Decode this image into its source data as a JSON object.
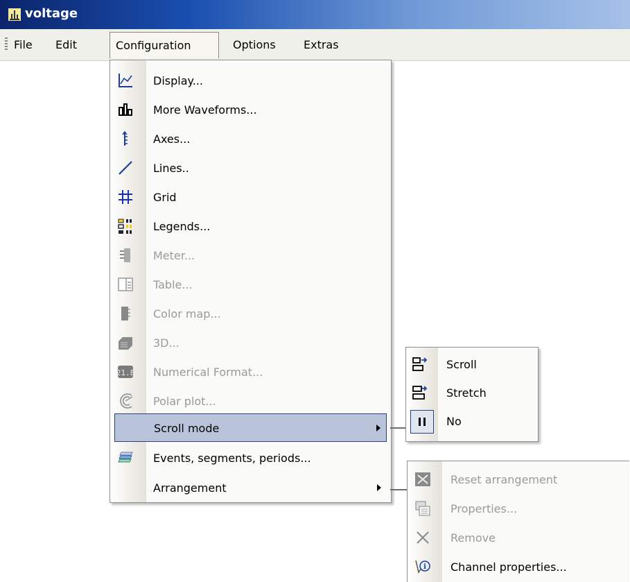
{
  "window": {
    "title": "voltage"
  },
  "menubar": {
    "items": [
      {
        "label": "File"
      },
      {
        "label": "Edit"
      },
      {
        "label": "Configuration"
      },
      {
        "label": "Options"
      },
      {
        "label": "Extras"
      }
    ]
  },
  "configuration_menu": {
    "items": [
      {
        "label": "Display...",
        "icon": "display-chart-icon",
        "enabled": true
      },
      {
        "label": "More Waveforms...",
        "icon": "more-waveforms-icon",
        "enabled": true
      },
      {
        "label": "Axes...",
        "icon": "axes-icon",
        "enabled": true
      },
      {
        "label": "Lines..",
        "icon": "lines-icon",
        "enabled": true
      },
      {
        "label": "Grid",
        "icon": "grid-icon",
        "enabled": true
      },
      {
        "label": "Legends...",
        "icon": "legends-icon",
        "enabled": true
      },
      {
        "label": "Meter...",
        "icon": "meter-icon",
        "enabled": false
      },
      {
        "label": "Table...",
        "icon": "table-icon",
        "enabled": false
      },
      {
        "label": "Color map...",
        "icon": "color-map-icon",
        "enabled": false
      },
      {
        "label": "3D...",
        "icon": "3d-icon",
        "enabled": false
      },
      {
        "label": "Numerical Format...",
        "icon": "numerical-format-icon",
        "enabled": false
      },
      {
        "label": "Polar plot...",
        "icon": "polar-plot-icon",
        "enabled": false
      },
      {
        "label": "Scroll mode",
        "icon": "",
        "enabled": true,
        "submenu": true,
        "highlighted": true
      },
      {
        "label": "Events, segments, periods...",
        "icon": "events-icon",
        "enabled": true
      },
      {
        "label": "Arrangement",
        "icon": "",
        "enabled": true,
        "submenu": true
      }
    ]
  },
  "scroll_mode_menu": {
    "items": [
      {
        "label": "Scroll",
        "icon": "scroll-icon"
      },
      {
        "label": "Stretch",
        "icon": "stretch-icon"
      },
      {
        "label": "No",
        "icon": "pause-icon",
        "checked": true
      }
    ]
  },
  "arrangement_menu": {
    "items": [
      {
        "label": "Reset arrangement",
        "icon": "reset-arrangement-icon",
        "enabled": false
      },
      {
        "label": "Properties...",
        "icon": "properties-icon",
        "enabled": false
      },
      {
        "label": "Remove",
        "icon": "remove-icon",
        "enabled": false
      },
      {
        "label": "Channel properties...",
        "icon": "channel-properties-icon",
        "enabled": true
      }
    ]
  },
  "colors": {
    "title_bar": "#0b246b",
    "highlight": "#b9c4da",
    "highlight_border": "#2d3f78",
    "disabled_text": "#9a9a9a"
  }
}
